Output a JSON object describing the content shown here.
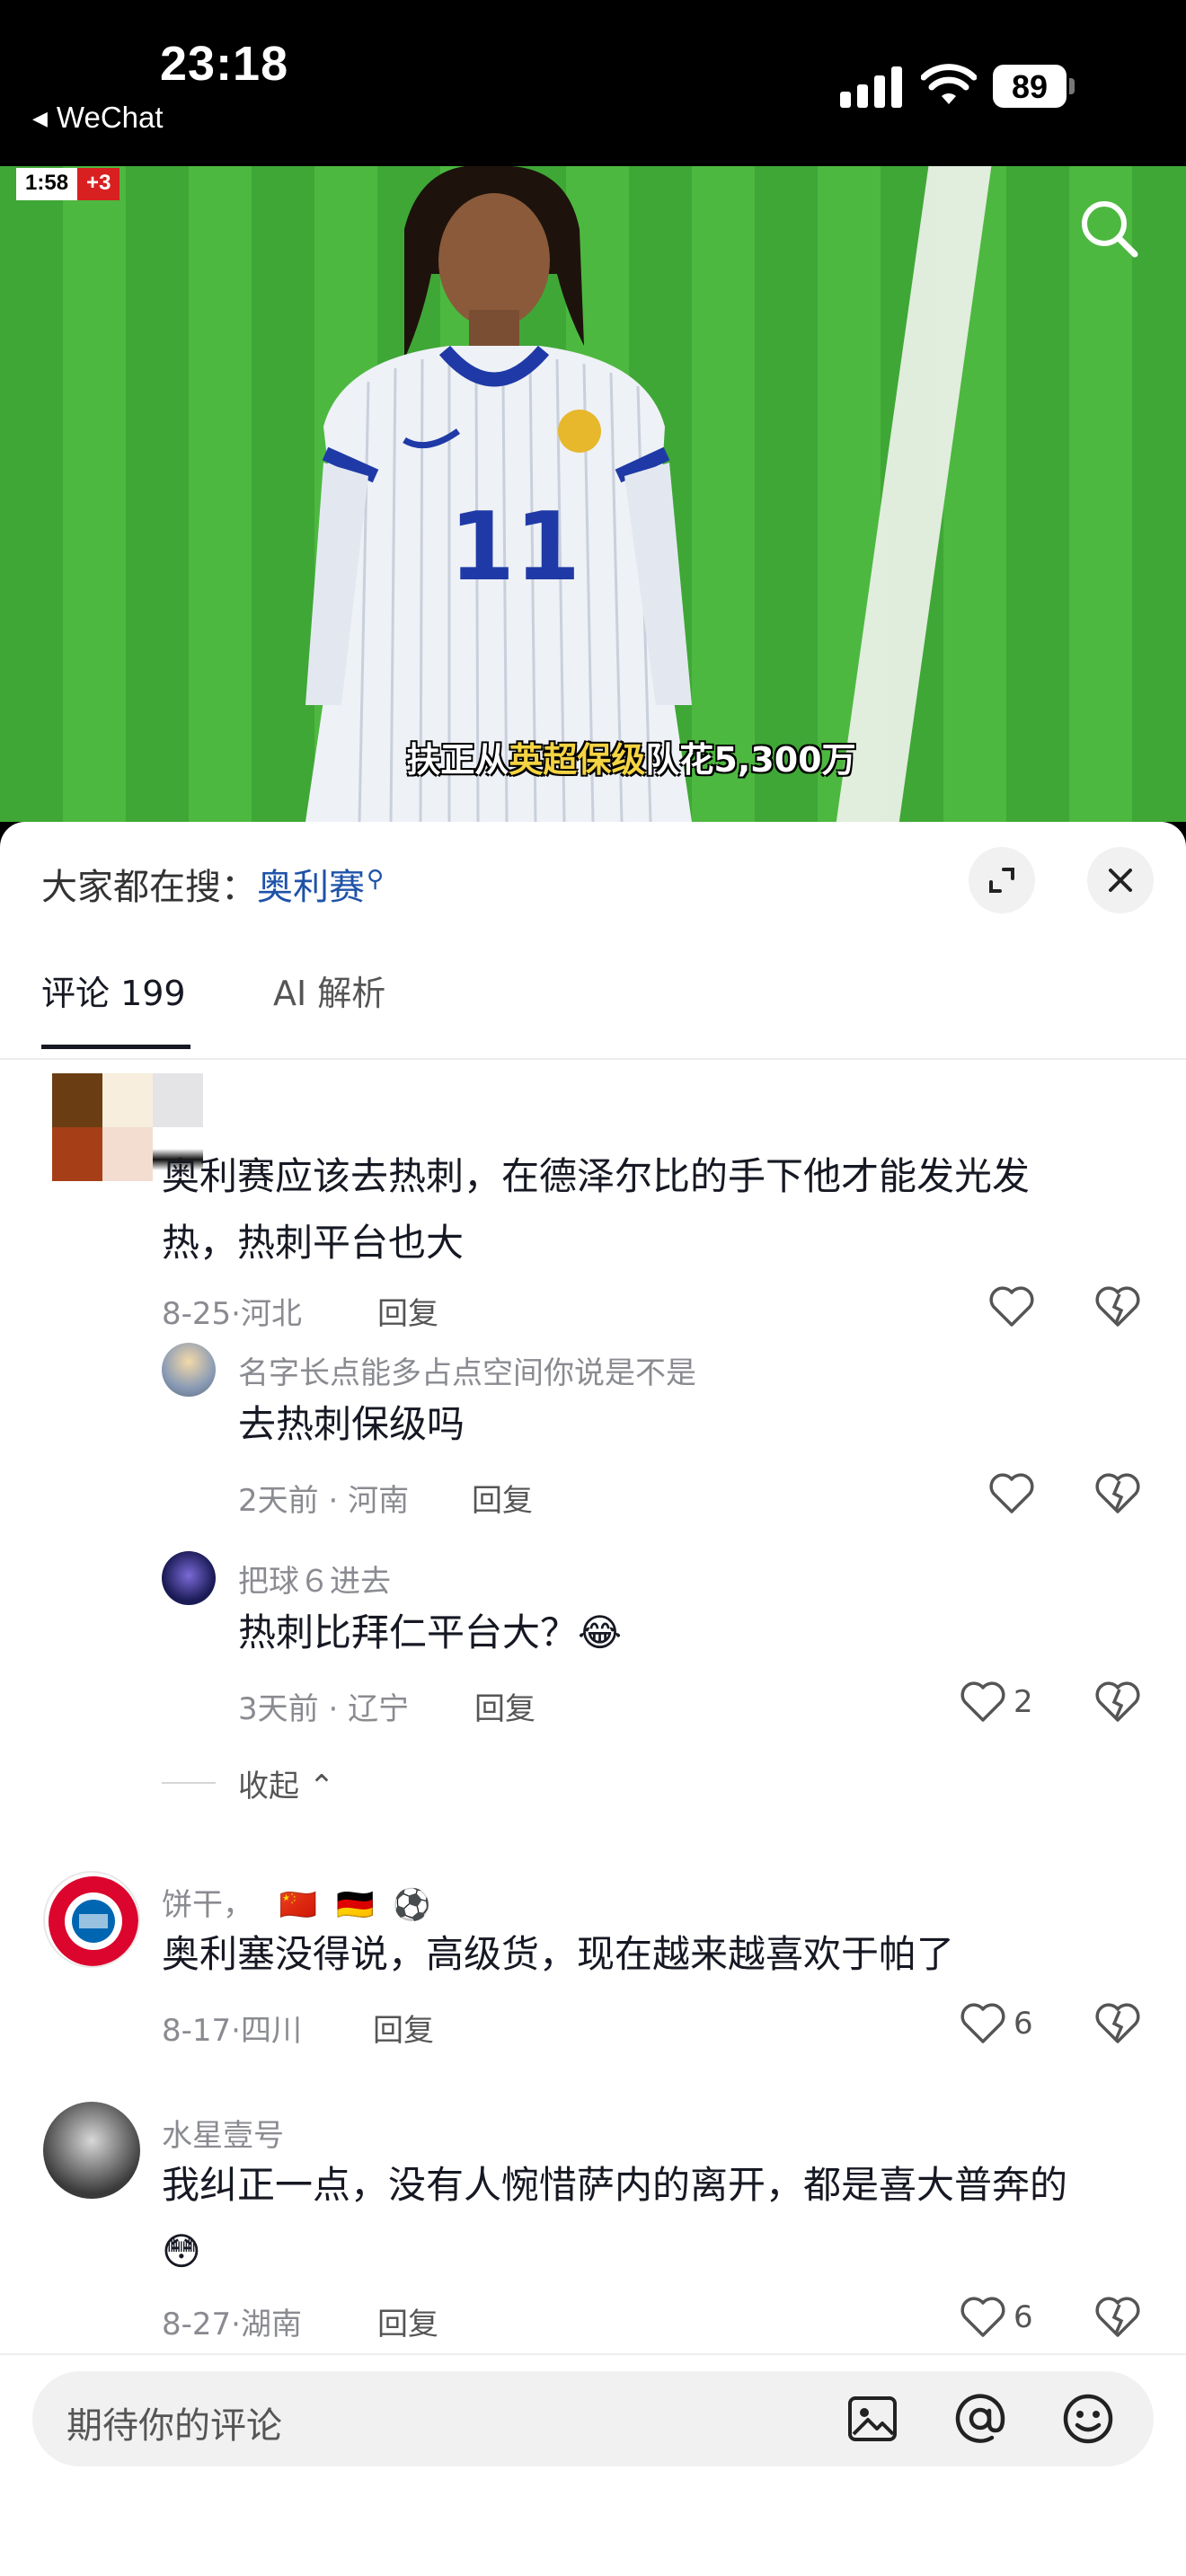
{
  "status_bar": {
    "time": "23:18",
    "back_app": "WeChat",
    "battery": "89"
  },
  "video": {
    "clock": "1:58",
    "added_time": "+3",
    "subtitle_pre": "扶正从",
    "subtitle_hl": "英超保级",
    "subtitle_post": "队花5,300万",
    "jersey_number": "11"
  },
  "hot_search": {
    "prefix": "大家都在搜：",
    "keyword": "奥利赛"
  },
  "tabs": {
    "comments": "评论 199",
    "ai": "AI 解析"
  },
  "comments": [
    {
      "text_line1": "奥利赛应该去热刺，在德泽尔比的手下他才能发光发",
      "text_line2": "热，热刺平台也大",
      "date": "8-25",
      "location": "河北",
      "reply_label": "回复",
      "replies": [
        {
          "username": "名字长点能多占点空间你说是不是",
          "text": "去热刺保级吗",
          "date": "2天前",
          "location": "河南",
          "reply_label": "回复",
          "likes": ""
        },
        {
          "username": "把球６进去",
          "text": "热刺比拜仁平台大？",
          "emoji": "😂",
          "date": "3天前",
          "location": "辽宁",
          "reply_label": "回复",
          "likes": "2"
        }
      ],
      "collapse_label": "收起"
    },
    {
      "username": "饼干，",
      "badges": [
        "🇨🇳",
        "🇩🇪",
        "⚽"
      ],
      "text": "奥利塞没得说，高级货，现在越来越喜欢于帕了",
      "date": "8-17",
      "location": "四川",
      "reply_label": "回复",
      "likes": "6"
    },
    {
      "username": "水星壹号",
      "text_line1": "我纠正一点，没有人惋惜萨内的离开，都是喜大普奔的",
      "emoji": "😳",
      "date": "8-27",
      "location": "湖南",
      "reply_label": "回复",
      "likes": "6"
    }
  ],
  "input": {
    "placeholder": "期待你的评论"
  },
  "colors": {
    "accent_link": "#1e52a8",
    "text": "#161823",
    "muted": "#8a8b91"
  }
}
